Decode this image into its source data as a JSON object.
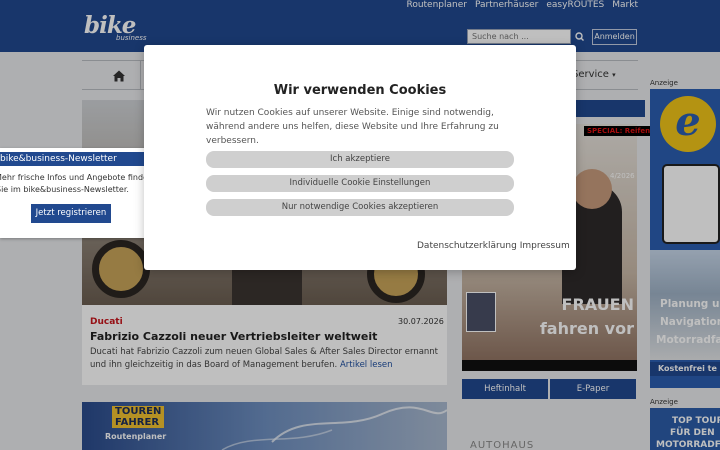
{
  "header": {
    "logo_text": "bike",
    "logo_sub": "business",
    "top_links": [
      "Routenplaner",
      "Partnerhäuser",
      "easyROUTES",
      "Markt"
    ],
    "search_placeholder": "Suche nach ...",
    "login_label": "Anmelden"
  },
  "nav": {
    "service_label": "Service"
  },
  "article": {
    "category": "Ducati",
    "date": "30.07.2026",
    "title": "Fabrizio Cazzoli neuer Vertriebsleiter weltweit",
    "text": "Ducati hat Fabrizio Cazzoli zum neuen Global Sales & After Sales Director ernannt und ihn gleichzeitig in das Board of Management berufen.",
    "link_label": "Artikel lesen"
  },
  "tourenfahrer": {
    "title_line1": "TOUREN",
    "title_line2": "FAHRER",
    "subtitle": "Routenplaner"
  },
  "magazine": {
    "special": "SPECIAL: Reifen",
    "issue": "4/2026",
    "headline_line1": "FRAUEN",
    "headline_line2": "fahren vor",
    "heftinhalt_label": "Heftinhalt",
    "epaper_label": "E-Paper"
  },
  "ads": {
    "label": "Anzeige",
    "ad1_logo": "e",
    "ad1_line1": "Planung u",
    "ad1_line2": "Navigation",
    "ad1_line3": "Motorradfa",
    "ad1_badge": "Kostenfrei te",
    "ad2_line1": "TOP TOURE",
    "ad2_line2": "FÜR DEN",
    "ad2_line3": "MOTORRADFAH"
  },
  "autohaus": "AUTOHAUS",
  "newsletter": {
    "title": "bike&business-Newsletter",
    "text_line1": "Mehr frische Infos und Angebote finden",
    "text_line2": "Sie im bike&business-Newsletter.",
    "button_label": "Jetzt registrieren"
  },
  "cookie": {
    "title": "Wir verwenden Cookies",
    "text": "Wir nutzen Cookies auf unserer Website. Einige sind notwendig, während andere uns helfen, diese Website und Ihre Erfahrung zu verbessern.",
    "accept_label": "Ich akzeptiere",
    "individual_label": "Individuelle Cookie Einstellungen",
    "necessary_label": "Nur notwendige Cookies akzeptieren",
    "privacy_label": "Datenschutzerklärung",
    "imprint_label": "Impressum"
  },
  "colors": {
    "brand_blue": "#21498f",
    "accent_red": "#c8161d"
  }
}
